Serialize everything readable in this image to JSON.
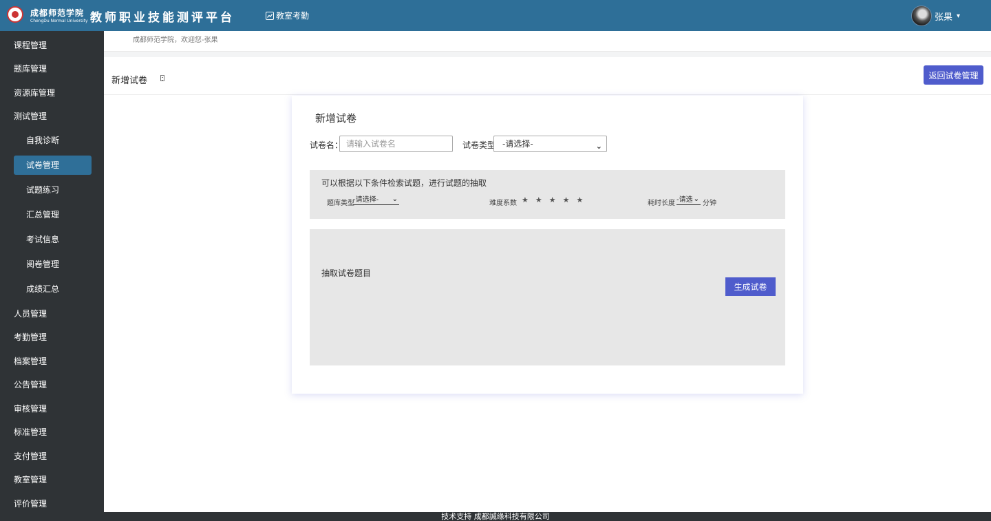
{
  "header": {
    "school_cn": "成都师范学院",
    "school_en": "ChengDu Normal University",
    "platform_title": "教师职业技能测评平台",
    "top_link": "教室考勤",
    "user_name": "张果",
    "caret": "▾"
  },
  "sidebar": {
    "items": [
      "课程管理",
      "题库管理",
      "资源库管理",
      "测试管理",
      "自我诊断",
      "试卷管理",
      "试题练习",
      "汇总管理",
      "考试信息",
      "阅卷管理",
      "成绩汇总",
      "人员管理",
      "考勤管理",
      "档案管理",
      "公告管理",
      "审核管理",
      "标准管理",
      "支付管理",
      "教室管理",
      "评价管理"
    ],
    "active": "试卷管理"
  },
  "welcome": "成都师范学院，欢迎您-张果",
  "page": {
    "title": "新增试卷",
    "back_button": "返回试卷管理"
  },
  "form": {
    "card_title": "新增试卷",
    "name_label": "试卷名：",
    "name_placeholder": "请输入试卷名",
    "type_label": "试卷类型:",
    "type_selected": "-请选择-",
    "filter_hint": "可以根据以下条件检索试题，进行试题的抽取",
    "bank_type_label": "题库类型",
    "bank_type_selected": "-请选择-",
    "difficulty_label": "难度系数",
    "difficulty_stars": 5,
    "duration_label": "耗时长度",
    "duration_selected": "-请选",
    "duration_unit": "分钟",
    "extract_label": "抽取试卷题目",
    "generate_button": "生成试卷"
  },
  "footer": "技术支持 成都諴缘科技有限公司",
  "colors": {
    "topbar": "#2e6f98",
    "sidebar": "#2f3336",
    "accent_button": "#4f5ccc",
    "panel_gray": "#e7e7e7"
  }
}
